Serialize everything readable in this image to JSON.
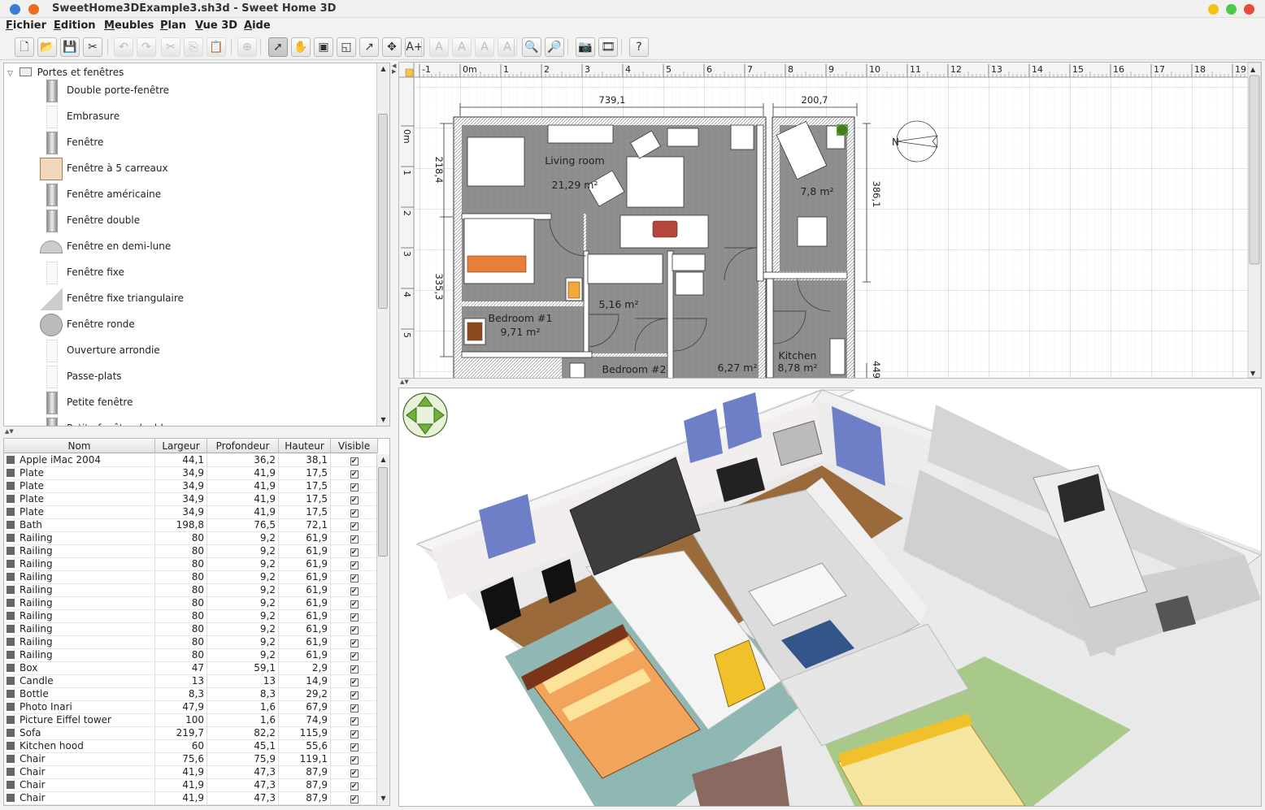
{
  "window": {
    "title": "SweetHome3DExample3.sh3d - Sweet Home 3D"
  },
  "menu": [
    {
      "accel": "F",
      "rest": "ichier"
    },
    {
      "accel": "E",
      "rest": "dition"
    },
    {
      "accel": "M",
      "rest": "eubles"
    },
    {
      "accel": "P",
      "rest": "lan"
    },
    {
      "accel": "V",
      "rest": "ue 3D"
    },
    {
      "accel": "A",
      "rest": "ide"
    }
  ],
  "toolbar": [
    {
      "name": "new-home",
      "glyph": "🗋",
      "state": "normal"
    },
    {
      "name": "open",
      "glyph": "📂",
      "state": "normal"
    },
    {
      "name": "save",
      "glyph": "💾",
      "state": "normal"
    },
    {
      "name": "preferences",
      "glyph": "✂",
      "state": "normal"
    },
    {
      "name": "undo",
      "glyph": "↶",
      "state": "disabled"
    },
    {
      "name": "redo",
      "glyph": "↷",
      "state": "disabled"
    },
    {
      "name": "cut",
      "glyph": "✂",
      "state": "disabled"
    },
    {
      "name": "copy",
      "glyph": "⎘",
      "state": "disabled"
    },
    {
      "name": "paste",
      "glyph": "📋",
      "state": "disabled"
    },
    {
      "name": "add-furniture",
      "glyph": "⊕",
      "state": "disabled"
    },
    {
      "name": "select-mode",
      "glyph": "➚",
      "state": "selected"
    },
    {
      "name": "pan-mode",
      "glyph": "✋",
      "state": "normal"
    },
    {
      "name": "create-walls",
      "glyph": "▣",
      "state": "normal"
    },
    {
      "name": "create-rooms",
      "glyph": "◱",
      "state": "normal"
    },
    {
      "name": "create-polylines",
      "glyph": "↗",
      "state": "normal"
    },
    {
      "name": "create-dimensions",
      "glyph": "✥",
      "state": "normal"
    },
    {
      "name": "add-text",
      "glyph": "A+",
      "state": "normal"
    },
    {
      "name": "text-bold",
      "glyph": "A",
      "state": "disabled"
    },
    {
      "name": "text-italic",
      "glyph": "A",
      "state": "disabled"
    },
    {
      "name": "text-enlarge",
      "glyph": "A",
      "state": "disabled"
    },
    {
      "name": "text-reduce",
      "glyph": "A",
      "state": "disabled"
    },
    {
      "name": "zoom-in",
      "glyph": "🔍",
      "state": "normal"
    },
    {
      "name": "zoom-out",
      "glyph": "🔎",
      "state": "normal"
    },
    {
      "name": "create-photo",
      "glyph": "📷",
      "state": "normal"
    },
    {
      "name": "create-video",
      "glyph": "🎞",
      "state": "normal"
    },
    {
      "name": "help",
      "glyph": "?",
      "state": "normal"
    }
  ],
  "catalog": {
    "category": "Portes et fenêtres",
    "items": [
      "Double porte-fenêtre",
      "Embrasure",
      "Fenêtre",
      "Fenêtre à 5 carreaux",
      "Fenêtre américaine",
      "Fenêtre double",
      "Fenêtre en demi-lune",
      "Fenêtre fixe",
      "Fenêtre fixe triangulaire",
      "Fenêtre ronde",
      "Ouverture arrondie",
      "Passe-plats",
      "Petite fenêtre",
      "Petite fenêtre double"
    ]
  },
  "furniture": {
    "columns": [
      "Nom",
      "Largeur",
      "Profondeur",
      "Hauteur",
      "Visible"
    ],
    "rows": [
      [
        "Apple iMac 2004",
        "44,1",
        "36,2",
        "38,1"
      ],
      [
        "Plate",
        "34,9",
        "41,9",
        "17,5"
      ],
      [
        "Plate",
        "34,9",
        "41,9",
        "17,5"
      ],
      [
        "Plate",
        "34,9",
        "41,9",
        "17,5"
      ],
      [
        "Plate",
        "34,9",
        "41,9",
        "17,5"
      ],
      [
        "Bath",
        "198,8",
        "76,5",
        "72,1"
      ],
      [
        "Railing",
        "80",
        "9,2",
        "61,9"
      ],
      [
        "Railing",
        "80",
        "9,2",
        "61,9"
      ],
      [
        "Railing",
        "80",
        "9,2",
        "61,9"
      ],
      [
        "Railing",
        "80",
        "9,2",
        "61,9"
      ],
      [
        "Railing",
        "80",
        "9,2",
        "61,9"
      ],
      [
        "Railing",
        "80",
        "9,2",
        "61,9"
      ],
      [
        "Railing",
        "80",
        "9,2",
        "61,9"
      ],
      [
        "Railing",
        "80",
        "9,2",
        "61,9"
      ],
      [
        "Railing",
        "80",
        "9,2",
        "61,9"
      ],
      [
        "Railing",
        "80",
        "9,2",
        "61,9"
      ],
      [
        "Box",
        "47",
        "59,1",
        "2,9"
      ],
      [
        "Candle",
        "13",
        "13",
        "14,9"
      ],
      [
        "Bottle",
        "8,3",
        "8,3",
        "29,2"
      ],
      [
        "Photo Inari",
        "47,9",
        "1,6",
        "67,9"
      ],
      [
        "Picture Eiffel tower",
        "100",
        "1,6",
        "74,9"
      ],
      [
        "Sofa",
        "219,7",
        "82,2",
        "115,9"
      ],
      [
        "Kitchen hood",
        "60",
        "45,1",
        "55,6"
      ],
      [
        "Chair",
        "75,6",
        "75,9",
        "119,1"
      ],
      [
        "Chair",
        "41,9",
        "47,3",
        "87,9"
      ],
      [
        "Chair",
        "41,9",
        "47,3",
        "87,9"
      ],
      [
        "Chair",
        "41,9",
        "47,3",
        "87,9"
      ]
    ],
    "visible_mark": "✔"
  },
  "plan": {
    "ruler_top": [
      "-1",
      "0m",
      "1",
      "2",
      "3",
      "4",
      "5",
      "6",
      "7",
      "8",
      "9",
      "10",
      "11",
      "12",
      "13",
      "14",
      "15",
      "16",
      "17",
      "18",
      "19"
    ],
    "ruler_left": [
      "0m",
      "1",
      "2",
      "3",
      "4",
      "5"
    ],
    "dimensions": {
      "top_left": "739,1",
      "top_right": "200,7",
      "left_upper": "218,4",
      "left_lower": "335,3",
      "right": "386,1",
      "right_bottom": "449"
    },
    "rooms": [
      {
        "name": "Living room",
        "area": "21,29 m²"
      },
      {
        "name": "",
        "area": "7,8 m²"
      },
      {
        "name": "",
        "area": "5,16 m²"
      },
      {
        "name": "Bedroom #1",
        "area": "9,71 m²"
      },
      {
        "name": "Bedroom #2",
        "area": ""
      },
      {
        "name": "",
        "area": "6,27 m²"
      },
      {
        "name": "Kitchen",
        "area": "8,78 m²"
      }
    ],
    "compass_letter": "N"
  },
  "colors": {
    "floor": "#8a8a8a",
    "wall": "#ffffff",
    "grid": "#d9e2ef",
    "wall3d_blue": "#6f7fc7",
    "floor_wood": "#9a6a3a",
    "floor_teal": "#8fb8b4",
    "floor_green": "#a9c98a"
  }
}
